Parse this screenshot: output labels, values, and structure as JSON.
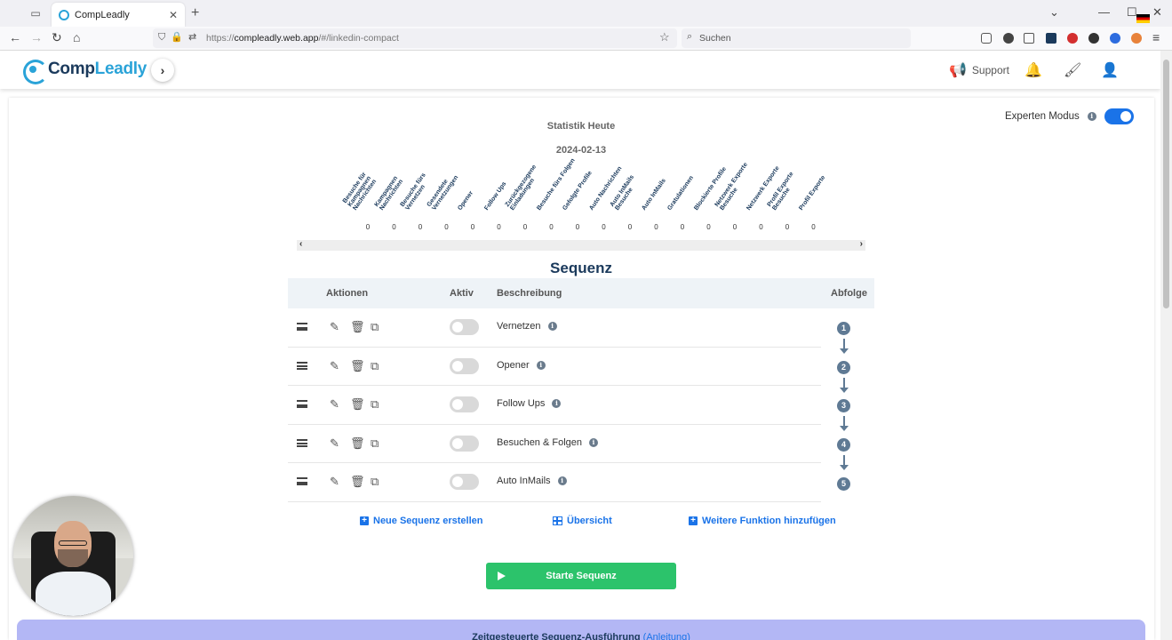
{
  "browser": {
    "tab_title": "CompLeadly",
    "url_prefix": "https://",
    "url_host": "compleadly.web.app",
    "url_path": "/#/linkedin-compact",
    "search_placeholder": "Suchen"
  },
  "header": {
    "logo_part1": "Comp",
    "logo_part2": "Leadly",
    "support_label": "Support"
  },
  "expert_mode": {
    "label": "Experten Modus",
    "enabled": true
  },
  "stats": {
    "title": "Statistik Heute",
    "date": "2024-02-13",
    "columns": [
      {
        "label": "Besuche für Kampagnen Nachrichten",
        "value": "0"
      },
      {
        "label": "Kampagnen Nachrichten",
        "value": "0"
      },
      {
        "label": "Besuche fürs Vernetzen",
        "value": "0"
      },
      {
        "label": "Gesendete Vernetzungen",
        "value": "0"
      },
      {
        "label": "Opener",
        "value": "0"
      },
      {
        "label": "Follow Ups",
        "value": "0"
      },
      {
        "label": "Zurückgezogene Einladungen",
        "value": "0"
      },
      {
        "label": "Besuche fürs Folgen",
        "value": "0"
      },
      {
        "label": "Gefolgte Profile",
        "value": "0"
      },
      {
        "label": "Auto Nachrichten",
        "value": "0"
      },
      {
        "label": "Auto InMails Besuche",
        "value": "0"
      },
      {
        "label": "Auto InMails",
        "value": "0"
      },
      {
        "label": "Gratulationen",
        "value": "0"
      },
      {
        "label": "Blockierte Profile",
        "value": "0"
      },
      {
        "label": "Netzwerk Exporte Besuche",
        "value": "0"
      },
      {
        "label": "Netzwerk Exporte",
        "value": "0"
      },
      {
        "label": "Profil Exporte Besuche",
        "value": "0"
      },
      {
        "label": "Profil Exporte",
        "value": "0"
      }
    ]
  },
  "sequence": {
    "title": "Sequenz",
    "headers": {
      "actions": "Aktionen",
      "active": "Aktiv",
      "description": "Beschreibung",
      "order": "Abfolge"
    },
    "rows": [
      {
        "description": "Vernetzen",
        "active": false,
        "order": "1"
      },
      {
        "description": "Opener",
        "active": false,
        "order": "2"
      },
      {
        "description": "Follow Ups",
        "active": false,
        "order": "3"
      },
      {
        "description": "Besuchen & Folgen",
        "active": false,
        "order": "4"
      },
      {
        "description": "Auto InMails",
        "active": false,
        "order": "5"
      }
    ],
    "links": {
      "new_sequence": "Neue Sequenz erstellen",
      "overview": "Übersicht",
      "add_function": "Weitere Funktion hinzufügen"
    },
    "start_button": "Starte Sequenz"
  },
  "timed": {
    "label": "Zeitgesteuerte Sequenz-Ausführung",
    "link": "(Anleitung)"
  },
  "colors": {
    "brand": "#2aa3d8",
    "navy": "#1b3a5c",
    "link": "#1a73e8",
    "start": "#2cc36b",
    "timed_bar": "#b3b7f5"
  }
}
